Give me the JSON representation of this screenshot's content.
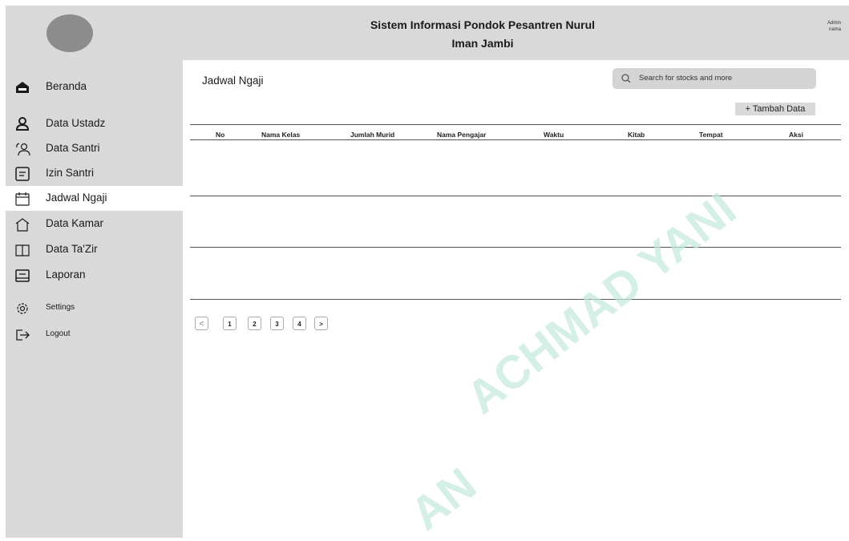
{
  "header": {
    "title_line1": "Sistem Informasi Pondok Pesantren Nurul",
    "title_line2": "Iman Jambi",
    "admin_line1": "Admin",
    "admin_line2": "nama"
  },
  "sidebar": {
    "items": [
      {
        "label": "Beranda",
        "icon": "home-icon"
      },
      {
        "label": "Data Ustadz",
        "icon": "user-icon"
      },
      {
        "label": "Data Santri",
        "icon": "users-icon"
      },
      {
        "label": "Izin Santri",
        "icon": "document-icon"
      },
      {
        "label": "Jadwal Ngaji",
        "icon": "calendar-icon",
        "active": true
      },
      {
        "label": "Data Kamar",
        "icon": "house-outline-icon"
      },
      {
        "label": "Data Ta'Zir",
        "icon": "book-icon"
      },
      {
        "label": "Laporan",
        "icon": "report-icon"
      },
      {
        "label": "Settings",
        "icon": "gear-icon"
      },
      {
        "label": "Logout",
        "icon": "logout-icon"
      }
    ]
  },
  "main": {
    "page_title": "Jadwal Ngaji",
    "search_placeholder": "Search for stocks and more",
    "add_button": "+ Tambah Data",
    "table": {
      "columns": [
        "No",
        "Nama Kelas",
        "Jumlah Murid",
        "Nama Pengajar",
        "Waktu",
        "Kitab",
        "Tempat",
        "Aksi"
      ],
      "rows": []
    },
    "pagination": {
      "prev": "<",
      "pages": [
        "1",
        "2",
        "3",
        "4"
      ],
      "next": ">"
    }
  },
  "watermark": {
    "line1": "ACHMAD YANI",
    "line2": "AN"
  },
  "colors": {
    "panel": "#d9d9d9",
    "logo": "#8c8c8c",
    "watermark": "#c2ebdc"
  }
}
